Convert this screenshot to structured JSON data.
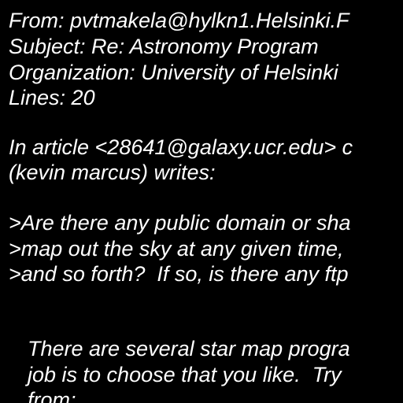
{
  "header": {
    "from": "From: pvtmakela@hylkn1.Helsinki.F",
    "subject": "Subject: Re: Astronomy Program",
    "organization": "Organization: University of Helsinki",
    "lines": "Lines: 20"
  },
  "attribution": [
    "In article <28641@galaxy.ucr.edu> c",
    "(kevin marcus) writes:"
  ],
  "quoted": [
    ">Are there any public domain or sha",
    ">map out the sky at any given time,",
    ">and so forth?  If so, is there any ftp"
  ],
  "reply": [
    "There are several star map progra",
    "job is to choose that you like.  Try",
    "from:"
  ],
  "colors": {
    "background": "#000000",
    "text": "#ffffff"
  }
}
